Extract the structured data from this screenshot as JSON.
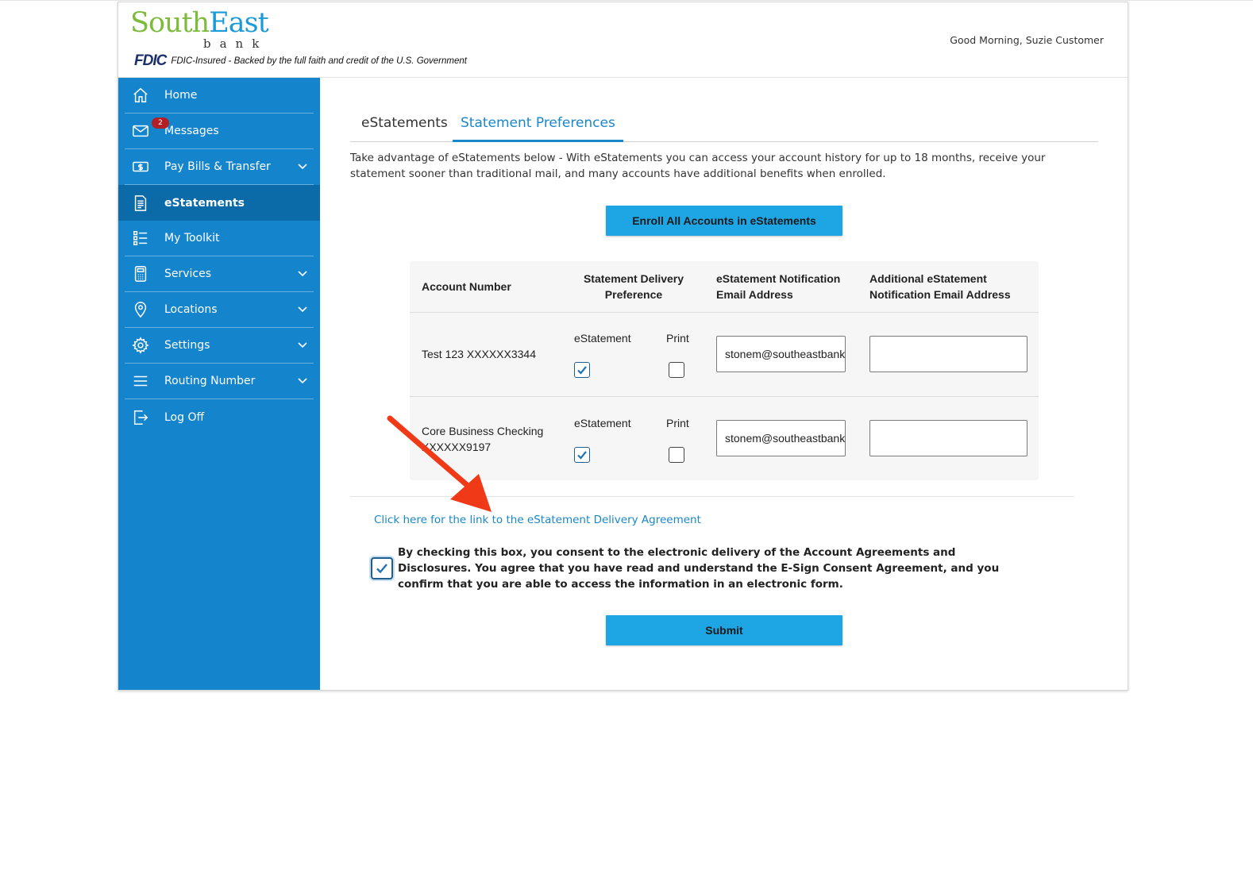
{
  "brand": {
    "name_part1": "South",
    "name_part2": "East",
    "name_sub": "bank",
    "fdic_mark": "FDIC",
    "fdic_text": "FDIC-Insured - Backed by the full faith and credit of the U.S. Government"
  },
  "header": {
    "greeting": "Good Morning, Suzie Customer"
  },
  "sidebar": {
    "items": [
      {
        "label": "Home",
        "icon": "home-icon"
      },
      {
        "label": "Messages",
        "icon": "envelope-icon",
        "badge": "2"
      },
      {
        "label": "Pay Bills & Transfer",
        "icon": "money-icon",
        "expandable": true
      },
      {
        "label": "eStatements",
        "icon": "document-icon",
        "active": true
      },
      {
        "label": "My Toolkit",
        "icon": "checklist-icon"
      },
      {
        "label": "Services",
        "icon": "calculator-icon",
        "expandable": true
      },
      {
        "label": "Locations",
        "icon": "map-pin-icon",
        "expandable": true
      },
      {
        "label": "Settings",
        "icon": "gear-icon",
        "expandable": true
      },
      {
        "label": "Routing Number",
        "icon": "menu-lines-icon",
        "expandable": true
      },
      {
        "label": "Log Off",
        "icon": "logout-icon"
      }
    ]
  },
  "tabs": [
    {
      "label": "eStatements",
      "active": false
    },
    {
      "label": "Statement Preferences",
      "active": true
    }
  ],
  "intro": "Take advantage of eStatements below - With eStatements you can access your account history for up to 18 months, receive your statement sooner than traditional mail, and many accounts have additional benefits when enrolled.",
  "enroll_button": "Enroll All Accounts in eStatements",
  "table": {
    "headers": {
      "account": "Account Number",
      "delivery": "Statement Delivery Preference",
      "email": "eStatement Notification Email Address",
      "additional": "Additional eStatement Notification Email Address"
    },
    "rows": [
      {
        "account": "Test 123 XXXXXX3344",
        "estatement_label": "eStatement",
        "print_label": "Print",
        "estatement": true,
        "print": false,
        "email": "stonem@southeastbank.com",
        "additional_email": ""
      },
      {
        "account": "Core Business Checking XXXXXX9197",
        "estatement_label": "eStatement",
        "print_label": "Print",
        "estatement": true,
        "print": false,
        "email": "stonem@southeastbank.com",
        "additional_email": ""
      }
    ]
  },
  "agreement_link": "Click here for the link to the eStatement Delivery Agreement",
  "consent": {
    "checked": true,
    "text": "By checking this box, you consent to the electronic delivery of the Account Agreements and Disclosures. You agree that you have read and understand the E-Sign Consent Agreement, and you confirm that you are able to access the information in an electronic form."
  },
  "submit_button": "Submit",
  "colors": {
    "sidebar": "#1484cd",
    "sidebar_active": "#0b6ba9",
    "button": "#1ea5e4",
    "link": "#1a87c9",
    "annotation_arrow": "#f03a17"
  }
}
